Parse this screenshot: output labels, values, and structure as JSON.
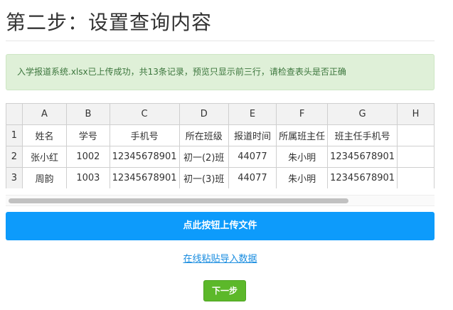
{
  "header": {
    "title": "第二步：设置查询内容"
  },
  "alert": {
    "message": "入学报道系统.xlsx已上传成功，共13条记录，预览只显示前三行，请检查表头是否正确"
  },
  "sheet": {
    "column_letters": [
      "A",
      "B",
      "C",
      "D",
      "E",
      "F",
      "G",
      "H"
    ],
    "rows": [
      {
        "num": "1",
        "cells": [
          "姓名",
          "学号",
          "手机号",
          "所在班级",
          "报道时间",
          "所属班主任",
          "班主任手机号",
          ""
        ]
      },
      {
        "num": "2",
        "cells": [
          "张小红",
          "1002",
          "12345678901",
          "初一(2)班",
          "44077",
          "朱小明",
          "12345678901",
          ""
        ]
      },
      {
        "num": "3",
        "cells": [
          "周韵",
          "1003",
          "12345678901",
          "初一(3)班",
          "44077",
          "朱小明",
          "12345678901",
          ""
        ]
      }
    ]
  },
  "actions": {
    "upload_label": "点此按钮上传文件",
    "paste_label": "在线粘贴导入数据",
    "next_label": "下一步"
  },
  "colors": {
    "alert_bg": "#dff0d8",
    "alert_text": "#3c763d",
    "primary": "#0d9bfb",
    "success": "#5cb82a",
    "link": "#1a8de0"
  }
}
